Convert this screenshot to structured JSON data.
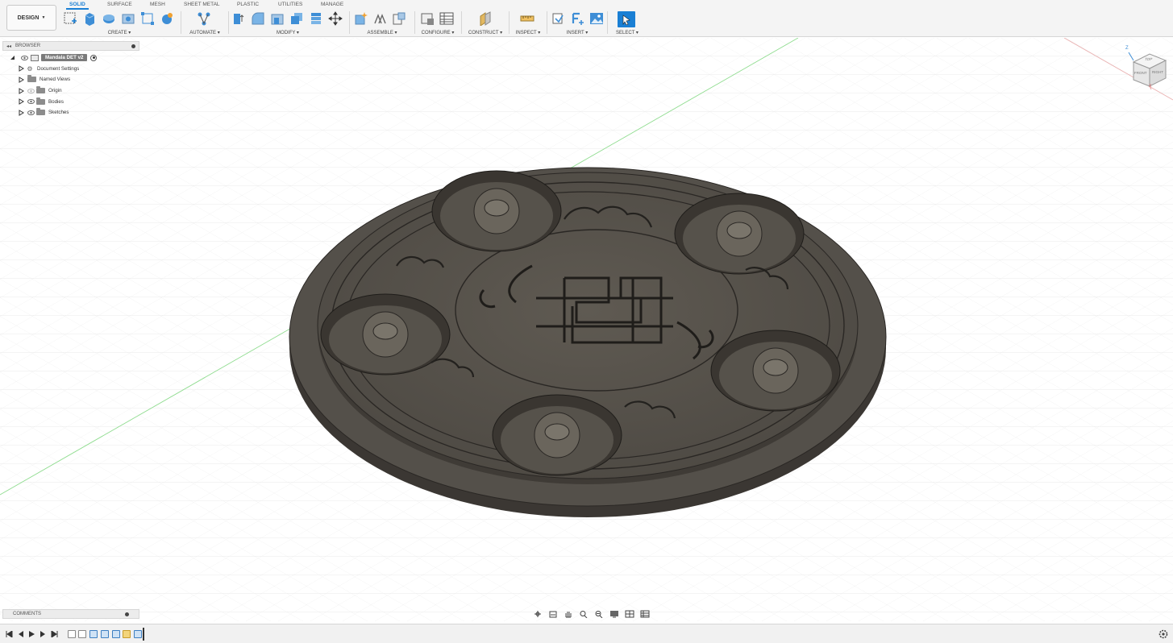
{
  "app": {
    "workspace_label": "DESIGN"
  },
  "tabs": [
    "SOLID",
    "SURFACE",
    "MESH",
    "SHEET METAL",
    "PLASTIC",
    "UTILITIES",
    "MANAGE"
  ],
  "tool_groups": {
    "create": "CREATE",
    "automate": "AUTOMATE",
    "modify": "MODIFY",
    "assemble": "ASSEMBLE",
    "configure": "CONFIGURE",
    "construct": "CONSTRUCT",
    "inspect": "INSPECT",
    "insert": "INSERT",
    "select": "SELECT"
  },
  "browser": {
    "title": "BROWSER",
    "root": "Mandala DET v2",
    "items": [
      "Document Settings",
      "Named Views",
      "Origin",
      "Bodies",
      "Sketches"
    ]
  },
  "comments": {
    "title": "COMMENTS"
  },
  "viewcube": {
    "top": "TOP",
    "front": "FRONT",
    "right": "RIGHT",
    "z_axis": "Z",
    "x_axis": "X"
  },
  "colors": {
    "accent": "#1a7fd4",
    "model": "#5a554d",
    "model_dark": "#3a3631",
    "model_edge": "#2a2724",
    "grid": "#e2e2e2",
    "axis_green": "#7fd07f",
    "axis_red": "#e8a4a4"
  },
  "icons": {
    "tabs_active": "solid",
    "select_tool": "cursor-arrow"
  }
}
